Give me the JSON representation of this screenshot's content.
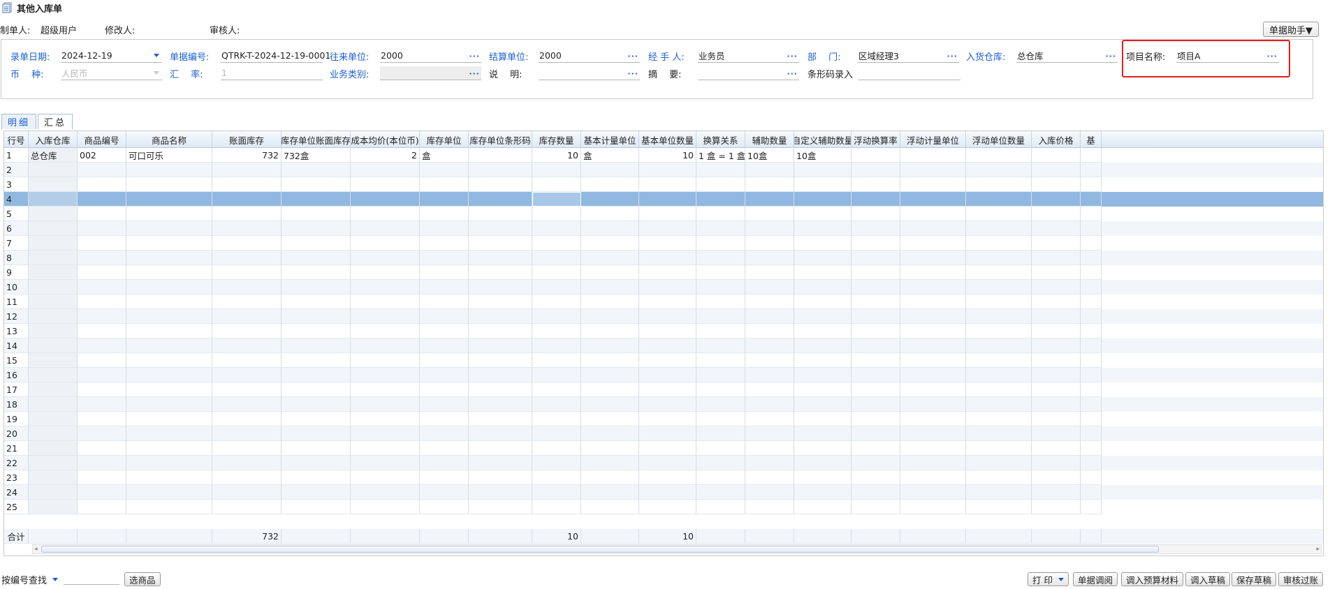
{
  "window": {
    "title": "其他入库单"
  },
  "meta": {
    "maker_label": "制单人:",
    "maker_value": "超级用户",
    "modifier_label": "修改人:",
    "modifier_value": "",
    "auditor_label": "审核人:",
    "auditor_value": "",
    "helper_button": "单据助手▼"
  },
  "form": {
    "date_label": "录单日期:",
    "date_value": "2024-12-19",
    "billno_label": "单据编号:",
    "billno_value": "QTRK-T-2024-12-19-0001",
    "partner_label": "往来单位:",
    "partner_value": "2000",
    "settle_label": "结算单位:",
    "settle_value": "2000",
    "handler_label": "经 手 人:",
    "handler_value": "业务员",
    "dept_label": "部　 门:",
    "dept_value": "区域经理3",
    "warehouse_label": "入货仓库:",
    "warehouse_value": "总仓库",
    "project_label": "项目名称:",
    "project_value": "项目A",
    "currency_label": "币　 种:",
    "currency_value": "人民币",
    "rate_label": "汇　 率:",
    "rate_value": "1",
    "biztype_label": "业务类别:",
    "biztype_value": "",
    "desc_label": "说　 明:",
    "desc_value": "",
    "summary_label": "摘　 要:",
    "summary_value": "",
    "barcode_label": "条形码录入",
    "barcode_value": "",
    "ellipsis": "···"
  },
  "tabs": [
    {
      "label": "明细",
      "active": true
    },
    {
      "label": "汇总",
      "active": false
    }
  ],
  "grid": {
    "columns": [
      "行号",
      "入库仓库",
      "商品编号",
      "商品名称",
      "账面库存",
      "库存单位账面库存",
      "成本均价(本位币)",
      "库存单位",
      "库存单位条形码",
      "库存数量",
      "基本计量单位",
      "基本单位数量",
      "换算关系",
      "辅助数量",
      "自定义辅助数量",
      "浮动换算率",
      "浮动计量单位",
      "浮动单位数量",
      "入库价格",
      "基"
    ],
    "rows": [
      [
        "1",
        "总仓库",
        "002",
        "可口可乐",
        "732",
        "732盒",
        "2",
        "盒",
        "",
        "10",
        "盒",
        "10",
        "1 盒 = 1 盒",
        "10盒",
        "10盒",
        "",
        "",
        "",
        "",
        ""
      ],
      [
        "2",
        "",
        "",
        "",
        "",
        "",
        "",
        "",
        "",
        "",
        "",
        "",
        "",
        "",
        "",
        "",
        "",
        "",
        "",
        ""
      ],
      [
        "3",
        "",
        "",
        "",
        "",
        "",
        "",
        "",
        "",
        "",
        "",
        "",
        "",
        "",
        "",
        "",
        "",
        "",
        "",
        ""
      ],
      [
        "4",
        "",
        "",
        "",
        "",
        "",
        "",
        "",
        "",
        "",
        "",
        "",
        "",
        "",
        "",
        "",
        "",
        "",
        "",
        ""
      ],
      [
        "5",
        "",
        "",
        "",
        "",
        "",
        "",
        "",
        "",
        "",
        "",
        "",
        "",
        "",
        "",
        "",
        "",
        "",
        "",
        ""
      ],
      [
        "6",
        "",
        "",
        "",
        "",
        "",
        "",
        "",
        "",
        "",
        "",
        "",
        "",
        "",
        "",
        "",
        "",
        "",
        "",
        ""
      ],
      [
        "7",
        "",
        "",
        "",
        "",
        "",
        "",
        "",
        "",
        "",
        "",
        "",
        "",
        "",
        "",
        "",
        "",
        "",
        "",
        ""
      ],
      [
        "8",
        "",
        "",
        "",
        "",
        "",
        "",
        "",
        "",
        "",
        "",
        "",
        "",
        "",
        "",
        "",
        "",
        "",
        "",
        ""
      ],
      [
        "9",
        "",
        "",
        "",
        "",
        "",
        "",
        "",
        "",
        "",
        "",
        "",
        "",
        "",
        "",
        "",
        "",
        "",
        "",
        ""
      ],
      [
        "10",
        "",
        "",
        "",
        "",
        "",
        "",
        "",
        "",
        "",
        "",
        "",
        "",
        "",
        "",
        "",
        "",
        "",
        "",
        ""
      ],
      [
        "11",
        "",
        "",
        "",
        "",
        "",
        "",
        "",
        "",
        "",
        "",
        "",
        "",
        "",
        "",
        "",
        "",
        "",
        "",
        ""
      ],
      [
        "12",
        "",
        "",
        "",
        "",
        "",
        "",
        "",
        "",
        "",
        "",
        "",
        "",
        "",
        "",
        "",
        "",
        "",
        "",
        ""
      ],
      [
        "13",
        "",
        "",
        "",
        "",
        "",
        "",
        "",
        "",
        "",
        "",
        "",
        "",
        "",
        "",
        "",
        "",
        "",
        "",
        ""
      ],
      [
        "14",
        "",
        "",
        "",
        "",
        "",
        "",
        "",
        "",
        "",
        "",
        "",
        "",
        "",
        "",
        "",
        "",
        "",
        "",
        ""
      ],
      [
        "15",
        "",
        "",
        "",
        "",
        "",
        "",
        "",
        "",
        "",
        "",
        "",
        "",
        "",
        "",
        "",
        "",
        "",
        "",
        ""
      ],
      [
        "16",
        "",
        "",
        "",
        "",
        "",
        "",
        "",
        "",
        "",
        "",
        "",
        "",
        "",
        "",
        "",
        "",
        "",
        "",
        ""
      ],
      [
        "17",
        "",
        "",
        "",
        "",
        "",
        "",
        "",
        "",
        "",
        "",
        "",
        "",
        "",
        "",
        "",
        "",
        "",
        "",
        ""
      ],
      [
        "18",
        "",
        "",
        "",
        "",
        "",
        "",
        "",
        "",
        "",
        "",
        "",
        "",
        "",
        "",
        "",
        "",
        "",
        "",
        ""
      ],
      [
        "19",
        "",
        "",
        "",
        "",
        "",
        "",
        "",
        "",
        "",
        "",
        "",
        "",
        "",
        "",
        "",
        "",
        "",
        "",
        ""
      ],
      [
        "20",
        "",
        "",
        "",
        "",
        "",
        "",
        "",
        "",
        "",
        "",
        "",
        "",
        "",
        "",
        "",
        "",
        "",
        "",
        ""
      ],
      [
        "21",
        "",
        "",
        "",
        "",
        "",
        "",
        "",
        "",
        "",
        "",
        "",
        "",
        "",
        "",
        "",
        "",
        "",
        "",
        ""
      ],
      [
        "22",
        "",
        "",
        "",
        "",
        "",
        "",
        "",
        "",
        "",
        "",
        "",
        "",
        "",
        "",
        "",
        "",
        "",
        "",
        ""
      ],
      [
        "23",
        "",
        "",
        "",
        "",
        "",
        "",
        "",
        "",
        "",
        "",
        "",
        "",
        "",
        "",
        "",
        "",
        "",
        "",
        ""
      ],
      [
        "24",
        "",
        "",
        "",
        "",
        "",
        "",
        "",
        "",
        "",
        "",
        "",
        "",
        "",
        "",
        "",
        "",
        "",
        "",
        ""
      ],
      [
        "25",
        "",
        "",
        "",
        "",
        "",
        "",
        "",
        "",
        "",
        "",
        "",
        "",
        "",
        "",
        "",
        "",
        "",
        "",
        ""
      ]
    ],
    "selected_row": 4,
    "sum_row": [
      "合计",
      "",
      "",
      "",
      "732",
      "",
      "",
      "",
      "",
      "10",
      "",
      "10",
      "",
      "",
      "",
      "",
      "",
      "",
      "",
      ""
    ]
  },
  "footer": {
    "search_mode": "按编号查找",
    "select_goods": "选商品",
    "print": "打 印",
    "bill_query": "单据调阅",
    "import_budget": "调入预算材料",
    "import_draft": "调入草稿",
    "save_draft": "保存草稿",
    "audit_pass": "审核过账"
  },
  "colors": {
    "accent": "#1a5fd0",
    "selected_row": "#90b8e0",
    "highlight_box": "#e02020"
  }
}
